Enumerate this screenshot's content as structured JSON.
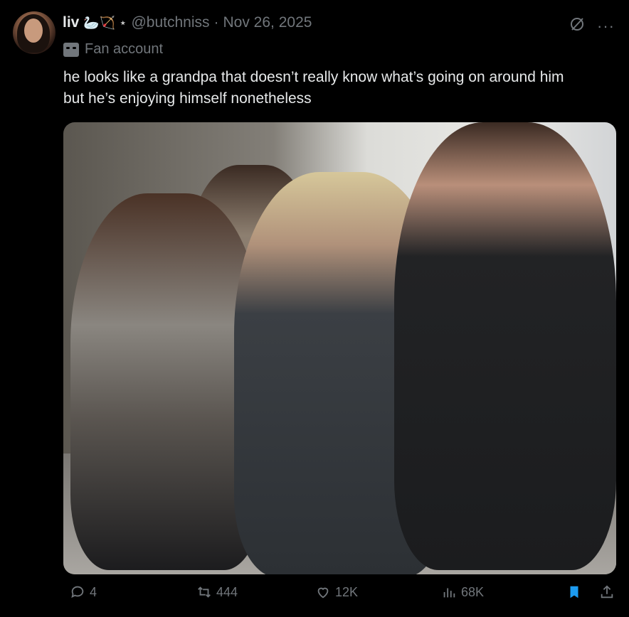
{
  "post": {
    "display_name": "liv",
    "name_emojis": "🦢🏹 ⋆",
    "handle": "@butchniss",
    "date": "Nov 26, 2025",
    "separator": "·",
    "label": "Fan account",
    "text_line1": "he looks like a grandpa that doesn’t really know what’s going on around him",
    "text_line2": "but he’s enjoying himself nonetheless",
    "more_label": "···"
  },
  "actions": {
    "replies": "4",
    "reposts": "444",
    "likes": "12K",
    "views": "68K"
  },
  "colors": {
    "background": "#000000",
    "muted": "#71767b",
    "text": "#e7e9ea",
    "bookmark_active": "#1d9bf0"
  },
  "icons": [
    "avatar",
    "mask-icon",
    "grok-icon",
    "more-icon",
    "reply-icon",
    "repost-icon",
    "like-icon",
    "views-icon",
    "bookmark-icon",
    "share-icon"
  ]
}
